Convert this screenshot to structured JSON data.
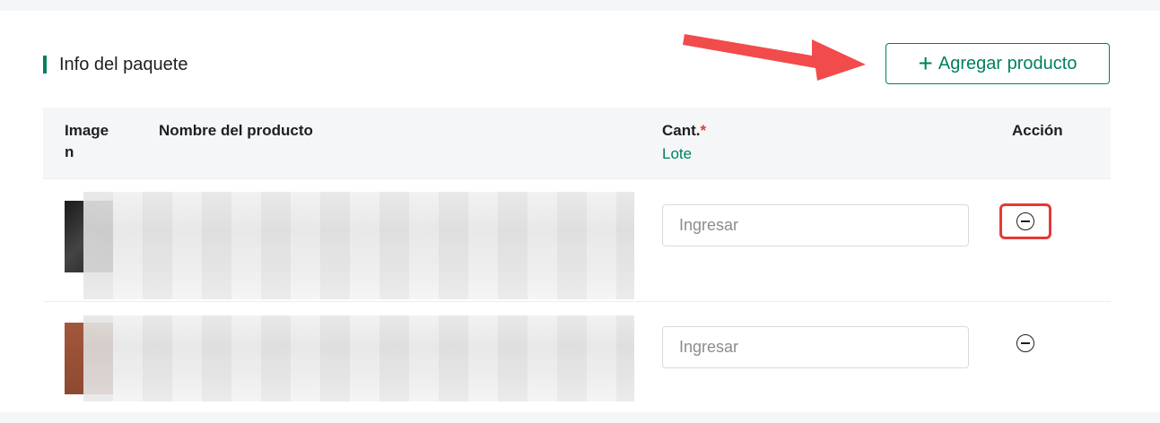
{
  "section": {
    "title": "Info del paquete",
    "accent_color": "#00805f"
  },
  "add_button": {
    "label": "Agregar producto",
    "icon": "plus-icon"
  },
  "annotation": {
    "arrow_color": "#f24b4b",
    "highlight_color": "#e53935"
  },
  "table": {
    "headers": {
      "image": "Imagen",
      "name": "Nombre del producto",
      "qty": "Cant.",
      "qty_required_mark": "*",
      "qty_unit": "Lote",
      "action": "Acción"
    },
    "rows": [
      {
        "thumbnail": "product-image",
        "name": "",
        "qty_placeholder": "Ingresar",
        "action_icon": "minus-circle-icon"
      },
      {
        "thumbnail": "product-image",
        "name": "",
        "qty_placeholder": "Ingresar",
        "action_icon": "minus-circle-icon"
      }
    ]
  }
}
